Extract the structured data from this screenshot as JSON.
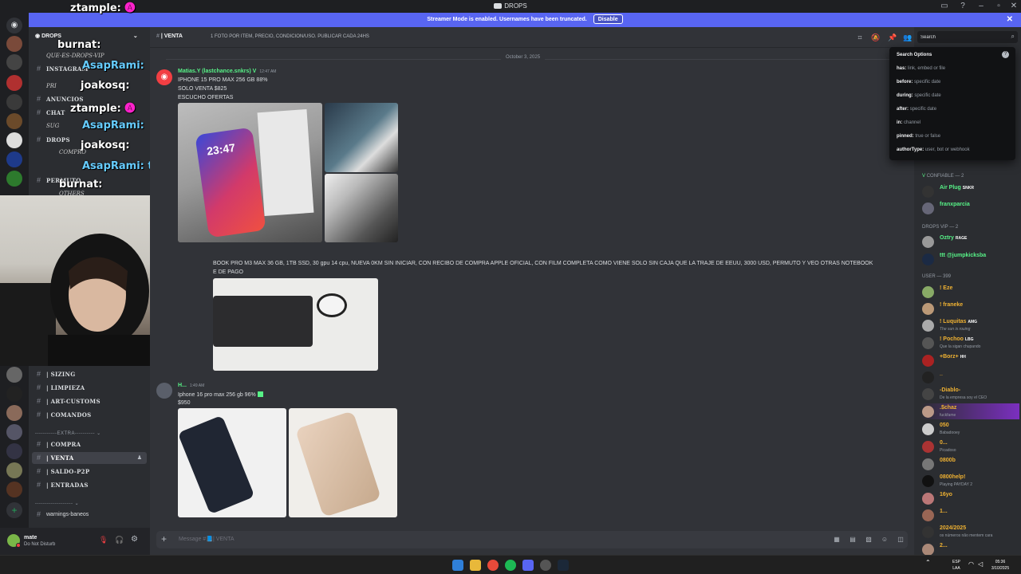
{
  "window": {
    "title": "DROPS"
  },
  "banner": {
    "text": "Streamer Mode is enabled. Usernames have been truncated.",
    "disable_label": "Disable"
  },
  "server": {
    "name": "DROPS"
  },
  "overlay": {
    "lines": [
      {
        "name": "ztample:",
        "emote": "🅐"
      },
      {
        "name": "burnat:"
      },
      {
        "name": "AsapRami:"
      },
      {
        "name": "joakosq:"
      },
      {
        "name": "ztample:",
        "emote": "🅐"
      },
      {
        "name": "AsapRami:"
      },
      {
        "name": "joakosq:"
      },
      {
        "name": "AsapRami: tu cvuello"
      },
      {
        "name": "burnat:"
      }
    ],
    "subs": [
      "QUE-ES-DROPS-VIP",
      "PRI",
      "SUG",
      "COMPRO",
      "OTHERS"
    ]
  },
  "sidebar": {
    "channels_top": [
      {
        "label": "INSTAGRAM"
      },
      {
        "label": "ANUNCIOS"
      },
      {
        "label": "CHAT"
      },
      {
        "label": "DROPS"
      },
      {
        "label": "PERMUTO"
      }
    ],
    "channels_bottom": [
      {
        "label": "| SIZING"
      },
      {
        "label": "| LIMPIEZA"
      },
      {
        "label": "| ART-CUSTOMS"
      },
      {
        "label": "| COMANDOS"
      }
    ],
    "extra_category": "EXTRA",
    "channels_extra": [
      {
        "label": "| COMPRA"
      },
      {
        "label": "| VENTA"
      },
      {
        "label": "| SALDO-P2P"
      },
      {
        "label": "| ENTRADAS"
      }
    ],
    "warnings_channel": "warnings-baneos"
  },
  "user": {
    "name": "mate",
    "status": "Do Not Disturb"
  },
  "channel": {
    "name": "| VENTA",
    "topic": "1 FOTO POR ITEM, PRECIO, CONDICION/USO. PUBLICAR CADA 24HS"
  },
  "chat": {
    "date_divider": "October 3, 2025",
    "messages": [
      {
        "author": "Matias.Y (lastchance.snkrs)",
        "time": "12:47 AM",
        "lines": [
          "IPHONE 15 PRO MAX 256 GB 88%",
          "SOLO VENTA $825",
          "ESCUCHO OFERTAS"
        ],
        "image_text": "23:47"
      },
      {
        "lines": [
          "BOOK PRO M3 MAX 36 GB, 1TB SSD,  30 gpu 14 cpu, NUEVA 0KM SIN INICIAR, CON RECIBO DE COMPRA APPLE OFICIAL, CON FILM COMPLETA COMO VIENE SOLO SIN CAJA QUE LA TRAJE DE EEUU, 3000 USD, PERMUTO Y VEO OTRAS NOTEBOOK",
          "E DE PAGO"
        ]
      },
      {
        "author": "H...",
        "time": "1:49 AM",
        "lines": [
          "Iphone 16 pro max 256 gb 96%",
          "$950"
        ]
      }
    ]
  },
  "composer": {
    "placeholder": "Message #📘| VENTA"
  },
  "search": {
    "value": "Search",
    "heading": "Search Options",
    "options": [
      {
        "key": "has:",
        "hint": "link, embed or file"
      },
      {
        "key": "before:",
        "hint": "specific date"
      },
      {
        "key": "during:",
        "hint": "specific date"
      },
      {
        "key": "after:",
        "hint": "specific date"
      },
      {
        "key": "in:",
        "hint": "channel"
      },
      {
        "key": "pinned:",
        "hint": "true or false"
      },
      {
        "key": "authorType:",
        "hint": "user, bot or webhook"
      }
    ]
  },
  "members": {
    "categories": [
      "CONFIABLE — 2",
      "DROPS VIP — 2",
      "USER — 399"
    ],
    "list": [
      {
        "name": "Air Plug",
        "tag": "SNKR",
        "color": "#57f287"
      },
      {
        "name": "franxparcia",
        "color": "#57f287"
      },
      {
        "name": "Oztry",
        "tag": "RAGE",
        "color": "#57f287"
      },
      {
        "name": "ttt @jumpkicksba",
        "color": "#57f287"
      },
      {
        "name": "! Eze",
        "color": "#f0b232"
      },
      {
        "name": "! franeke",
        "color": "#f0b232"
      },
      {
        "name": "! Luquitas",
        "tag": "AMG",
        "activity": "The sun is rouing",
        "color": "#f0b232"
      },
      {
        "name": "! Pochoo",
        "tag": "LBG",
        "activity": "Que la sigan chupando",
        "color": "#f0b232"
      },
      {
        "name": "+Borz+",
        "tag": "HH",
        "color": "#f0b232"
      },
      {
        "name": "_",
        "color": "#f0b232"
      },
      {
        "name": "-Diablo-",
        "activity": "De la empresa soy el CEO",
        "color": "#f0b232"
      },
      {
        "name": ".$chaz",
        "activity": "fuckfame",
        "color": "#f0b232"
      },
      {
        "name": "050",
        "activity": "Babadooey",
        "color": "#f0b232"
      },
      {
        "name": "0...",
        "activity": "Picadoso",
        "color": "#f0b232"
      },
      {
        "name": "0800b",
        "color": "#f0b232"
      },
      {
        "name": "0800help!",
        "activity": "Playing PAYDAY 2",
        "color": "#f0b232"
      },
      {
        "name": "16yo",
        "color": "#f0b232"
      },
      {
        "name": "1...",
        "color": "#f0b232"
      },
      {
        "name": "2024/2025",
        "activity": "os números não mentem cara",
        "color": "#f0b232"
      },
      {
        "name": "2...",
        "color": "#f0b232"
      }
    ]
  },
  "taskbar": {
    "lang_top": "ESP",
    "lang_bottom": "LAA",
    "time": "05:36",
    "date": "3/10/2025"
  }
}
